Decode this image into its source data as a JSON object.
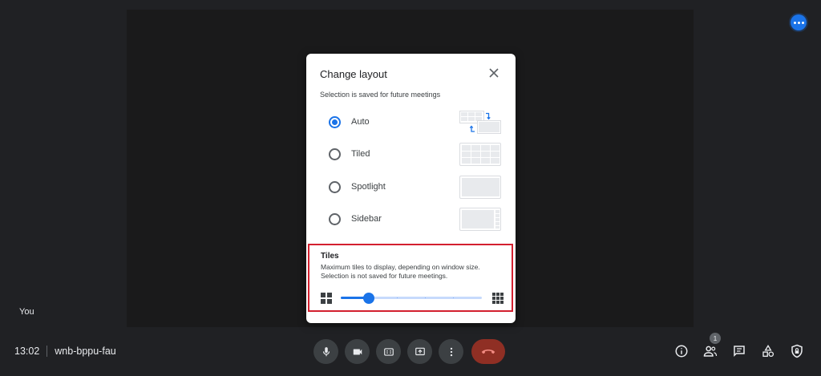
{
  "self_view": {
    "label": "You"
  },
  "meeting": {
    "time": "13:02",
    "code": "wnb-bppu-fau"
  },
  "people": {
    "count": "1"
  },
  "dialog": {
    "title": "Change layout",
    "note": "Selection is saved for future meetings",
    "options": [
      {
        "label": "Auto",
        "selected": true
      },
      {
        "label": "Tiled",
        "selected": false
      },
      {
        "label": "Spotlight",
        "selected": false
      },
      {
        "label": "Sidebar",
        "selected": false
      }
    ],
    "tiles": {
      "title": "Tiles",
      "desc_line1": "Maximum tiles to display, depending on window size.",
      "desc_line2": "Selection is not saved for future meetings.",
      "slider_fraction": 0.2
    }
  },
  "colors": {
    "accent": "#1a73e8",
    "end_call": "#8f2f24",
    "highlight_border": "#d3202f",
    "background": "#202124"
  }
}
